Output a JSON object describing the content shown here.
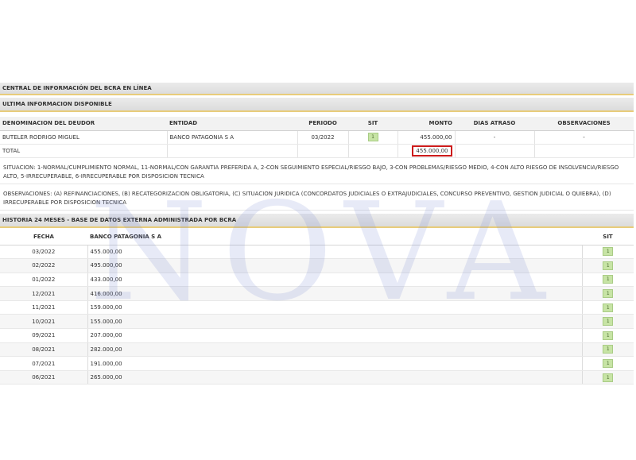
{
  "watermark": "NOVA",
  "panel_title": "CENTRAL DE INFORMACIÓN DEL BCRA EN LÍNEA",
  "section1_title": "ULTIMA INFORMACION DISPONIBLE",
  "columns": {
    "denominacion": "DENOMINACION DEL DEUDOR",
    "entidad": "ENTIDAD",
    "periodo": "PERIODO",
    "sit": "SIT",
    "monto": "MONTO",
    "dias": "DIAS ATRASO",
    "obs": "OBSERVACIONES"
  },
  "row": {
    "deudor": "BUTELER RODRIGO MIGUEL",
    "entidad": "BANCO PATAGONIA S A",
    "periodo": "03/2022",
    "sit": "1",
    "monto": "455.000,00",
    "dias": "-",
    "obs": "-"
  },
  "total": {
    "label": "TOTAL",
    "monto": "455.000,00"
  },
  "situacion_text": "SITUACION: 1-NORMAL/CUMPLIMIENTO NORMAL, 11-NORMAL/CON GARANTIA PREFERIDA A, 2-CON SEGUIMIENTO ESPECIAL/RIESGO BAJO, 3-CON PROBLEMAS/RIESGO MEDIO, 4-CON ALTO RIESGO DE INSOLVENCIA/RIESGO ALTO, 5-IRRECUPERABLE, 6-IRRECUPERABLE POR DISPOSICION TECNICA",
  "observaciones_text": "OBSERVACIONES: (A) REFINANCIACIONES, (B) RECATEGORIZACION OBLIGATORIA, (C) SITUACION JURIDICA (CONCORDATOS JUDICIALES O EXTRAJUDICIALES, CONCURSO PREVENTIVO, GESTION JUDICIAL O QUIEBRA), (D) IRRECUPERABLE POR DISPOSICION TECNICA",
  "history_title": "HISTORIA 24 MESES - BASE DE DATOS EXTERNA ADMINISTRADA POR BCRA",
  "history_columns": {
    "fecha": "FECHA",
    "banco": "BANCO PATAGONIA S A",
    "sit": "SIT"
  },
  "history": [
    {
      "fecha": "03/2022",
      "monto": "455.000,00",
      "sit": "1"
    },
    {
      "fecha": "02/2022",
      "monto": "495.000,00",
      "sit": "1"
    },
    {
      "fecha": "01/2022",
      "monto": "433.000,00",
      "sit": "1"
    },
    {
      "fecha": "12/2021",
      "monto": "416.000,00",
      "sit": "1"
    },
    {
      "fecha": "11/2021",
      "monto": "159.000,00",
      "sit": "1"
    },
    {
      "fecha": "10/2021",
      "monto": "155.000,00",
      "sit": "1"
    },
    {
      "fecha": "09/2021",
      "monto": "207.000,00",
      "sit": "1"
    },
    {
      "fecha": "08/2021",
      "monto": "282.000,00",
      "sit": "1"
    },
    {
      "fecha": "07/2021",
      "monto": "191.000,00",
      "sit": "1"
    },
    {
      "fecha": "06/2021",
      "monto": "265.000,00",
      "sit": "1"
    }
  ],
  "colors": {
    "header_bg": "#dcdcdc",
    "accent_line": "#e8cc7a",
    "highlight": "#cc1b1b",
    "badge": "#c7e4a5"
  }
}
